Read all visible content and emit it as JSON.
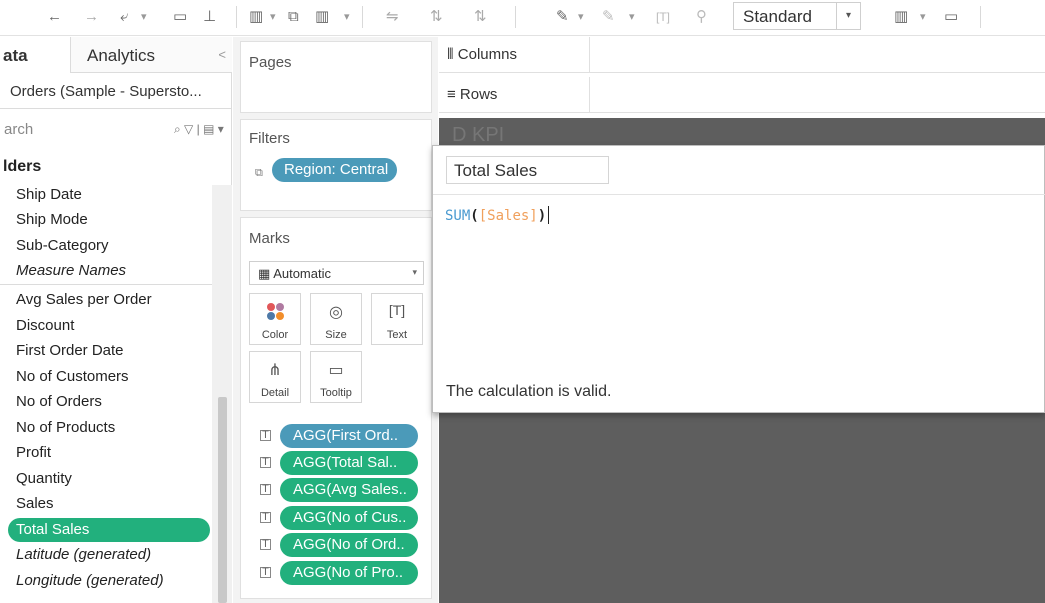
{
  "toolbar": {
    "back_glyph": "←",
    "forward_glyph": "→",
    "standard_value": "Standard"
  },
  "data_pane": {
    "tab_data": "ata",
    "tab_analytics": "Analytics",
    "datasource": "Orders (Sample - Supersto...",
    "search_placeholder": "arch",
    "folder": "lders",
    "dimensions": [
      "Ship Date",
      "Ship Mode",
      "Sub-Category",
      "Measure Names"
    ],
    "measures": [
      "Avg Sales per Order",
      "Discount",
      "First Order Date",
      "No of Customers",
      "No of Orders",
      "No of Products",
      "Profit",
      "Quantity",
      "Sales",
      "Total Sales",
      "Latitude (generated)",
      "Longitude (generated)"
    ],
    "selected_field": "Total Sales"
  },
  "shelves": {
    "pages": "Pages",
    "filters": "Filters",
    "filter_pill": "Region: Central",
    "marks": "Marks",
    "mark_type": "Automatic",
    "mark_buttons": [
      "Color",
      "Size",
      "Text",
      "Detail",
      "Tooltip"
    ],
    "mark_pills": [
      "AGG(First Ord..",
      "AGG(Total Sal..",
      "AGG(Avg Sales..",
      "AGG(No of Cus..",
      "AGG(No of Ord..",
      "AGG(No of Pro.."
    ],
    "columns": "Columns",
    "rows": "Rows"
  },
  "view": {
    "ghost_title": "D KPI"
  },
  "calc_editor": {
    "name": "Total Sales",
    "formula_fn": "SUM",
    "formula_field": "[Sales]",
    "status": "The calculation is valid."
  },
  "colors": {
    "green_pill": "#22b07d",
    "blue_pill": "#4b9ab9",
    "view_bg": "#5e5e5e"
  }
}
